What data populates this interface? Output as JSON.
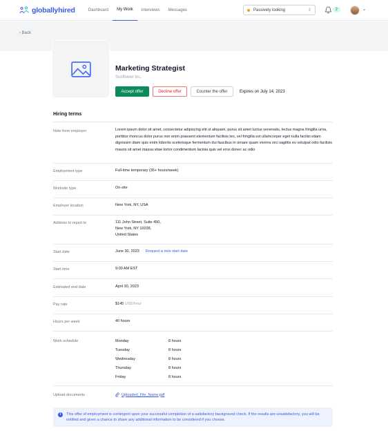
{
  "brand": {
    "name": "globallyhired"
  },
  "nav": [
    {
      "label": "Dashboard",
      "active": false
    },
    {
      "label": "My Work",
      "active": true
    },
    {
      "label": "Interviews",
      "active": false
    },
    {
      "label": "Messages",
      "active": false
    }
  ],
  "status": {
    "value": "Passively looking",
    "dot_color": "#f59e0b"
  },
  "notifications": {
    "count": "2"
  },
  "back_label": "Back",
  "job": {
    "title": "Marketing Strategist",
    "company": "Sunflower Inc.",
    "accept_label": "Accept offer",
    "decline_label": "Decline offer",
    "counter_label": "Counter the offer",
    "expires": "Expires on July 14, 2023"
  },
  "hiring_terms": {
    "title": "Hiring terms",
    "note_label": "Note from employer",
    "note": "Lorem ipsum dolor sit amet, consectetur adipiscing elit ut aliquam, purus sit amet luctus venenatis, lectus magna fringilla urna, porttitor rhoncus dolor purus non enim praesent elementum facilisis leo, vel fringilla est ullamcorper eget nulla facilisi etiam dignissim diam quis enim lobortis scelerisque fermentum dui faucibus in ornare quam viverra orci sagittis eu volutpat odio facilisis mauris sit amet massa vitae tortor condimentum lacinia quis vel eros donec ac odio",
    "employment_type_label": "Employment type",
    "employment_type": "Full-time temporary (35+ hours/week)",
    "worksite_type_label": "Worksite type",
    "worksite_type": "On-site",
    "employer_location_label": "Employer location",
    "employer_location": "New York, NY, USA",
    "address_label": "Address to report to",
    "address_line1": "111 John Street, Suite 450,",
    "address_line2": "New York, NY 10038,",
    "address_line3": "United States",
    "start_date_label": "Start date",
    "start_date": "June 30, 2023",
    "request_new_start": "Request a new start date",
    "start_time_label": "Start time",
    "start_time": "9:00 AM EST",
    "end_date_label": "Estimated end date",
    "end_date": "April 30, 2023",
    "pay_rate_label": "Pay rate",
    "pay_rate": "$145",
    "pay_rate_unit": "USD/hour",
    "hours_label": "Hours per week",
    "hours": "40 hours",
    "schedule_label": "Work schedule",
    "schedule": [
      {
        "day": "Monday",
        "hours": "8 hours"
      },
      {
        "day": "Tuesday",
        "hours": "8 hours"
      },
      {
        "day": "Wednesday",
        "hours": "8 hours"
      },
      {
        "day": "Thursday",
        "hours": "8 hours"
      },
      {
        "day": "Friday",
        "hours": "8 hours"
      }
    ],
    "upload_label": "Upload documents",
    "upload_file": "Uploaded_File_Name.pdf"
  },
  "info_notice": "This offer of employment is contingent upon your successful completion of a satisfactory background check. If the results are unsatisfactory, you will be notified and given a chance to share any additional information to be considered if you choose.",
  "colors": {
    "accent": "#3b5bdb",
    "accept": "#0c8a5a",
    "decline": "#dc2626"
  }
}
